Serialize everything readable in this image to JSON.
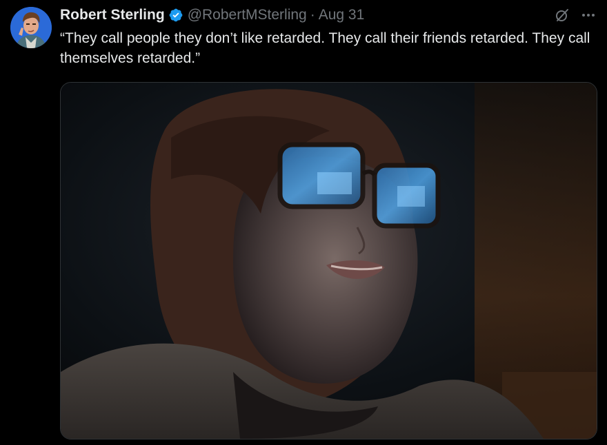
{
  "author": {
    "display_name": "Robert Sterling",
    "handle": "@RobertMSterling",
    "verified_icon": "verified-badge-icon",
    "avatar_icon": "avatar"
  },
  "meta": {
    "separator": "·",
    "timestamp": "Aug 31"
  },
  "actions": {
    "grok_icon": "grok-icon",
    "more_icon": "more-options-icon"
  },
  "tweet": {
    "text": "“They call people they don’t like retarded. They call their friends retarded. They call themselves retarded.”"
  },
  "media": {
    "type": "photo"
  },
  "colors": {
    "background": "#000000",
    "primary_text": "#e7e9ea",
    "secondary_text": "#71767b",
    "verified_blue": "#1d9bf0",
    "border": "#2f3336"
  }
}
